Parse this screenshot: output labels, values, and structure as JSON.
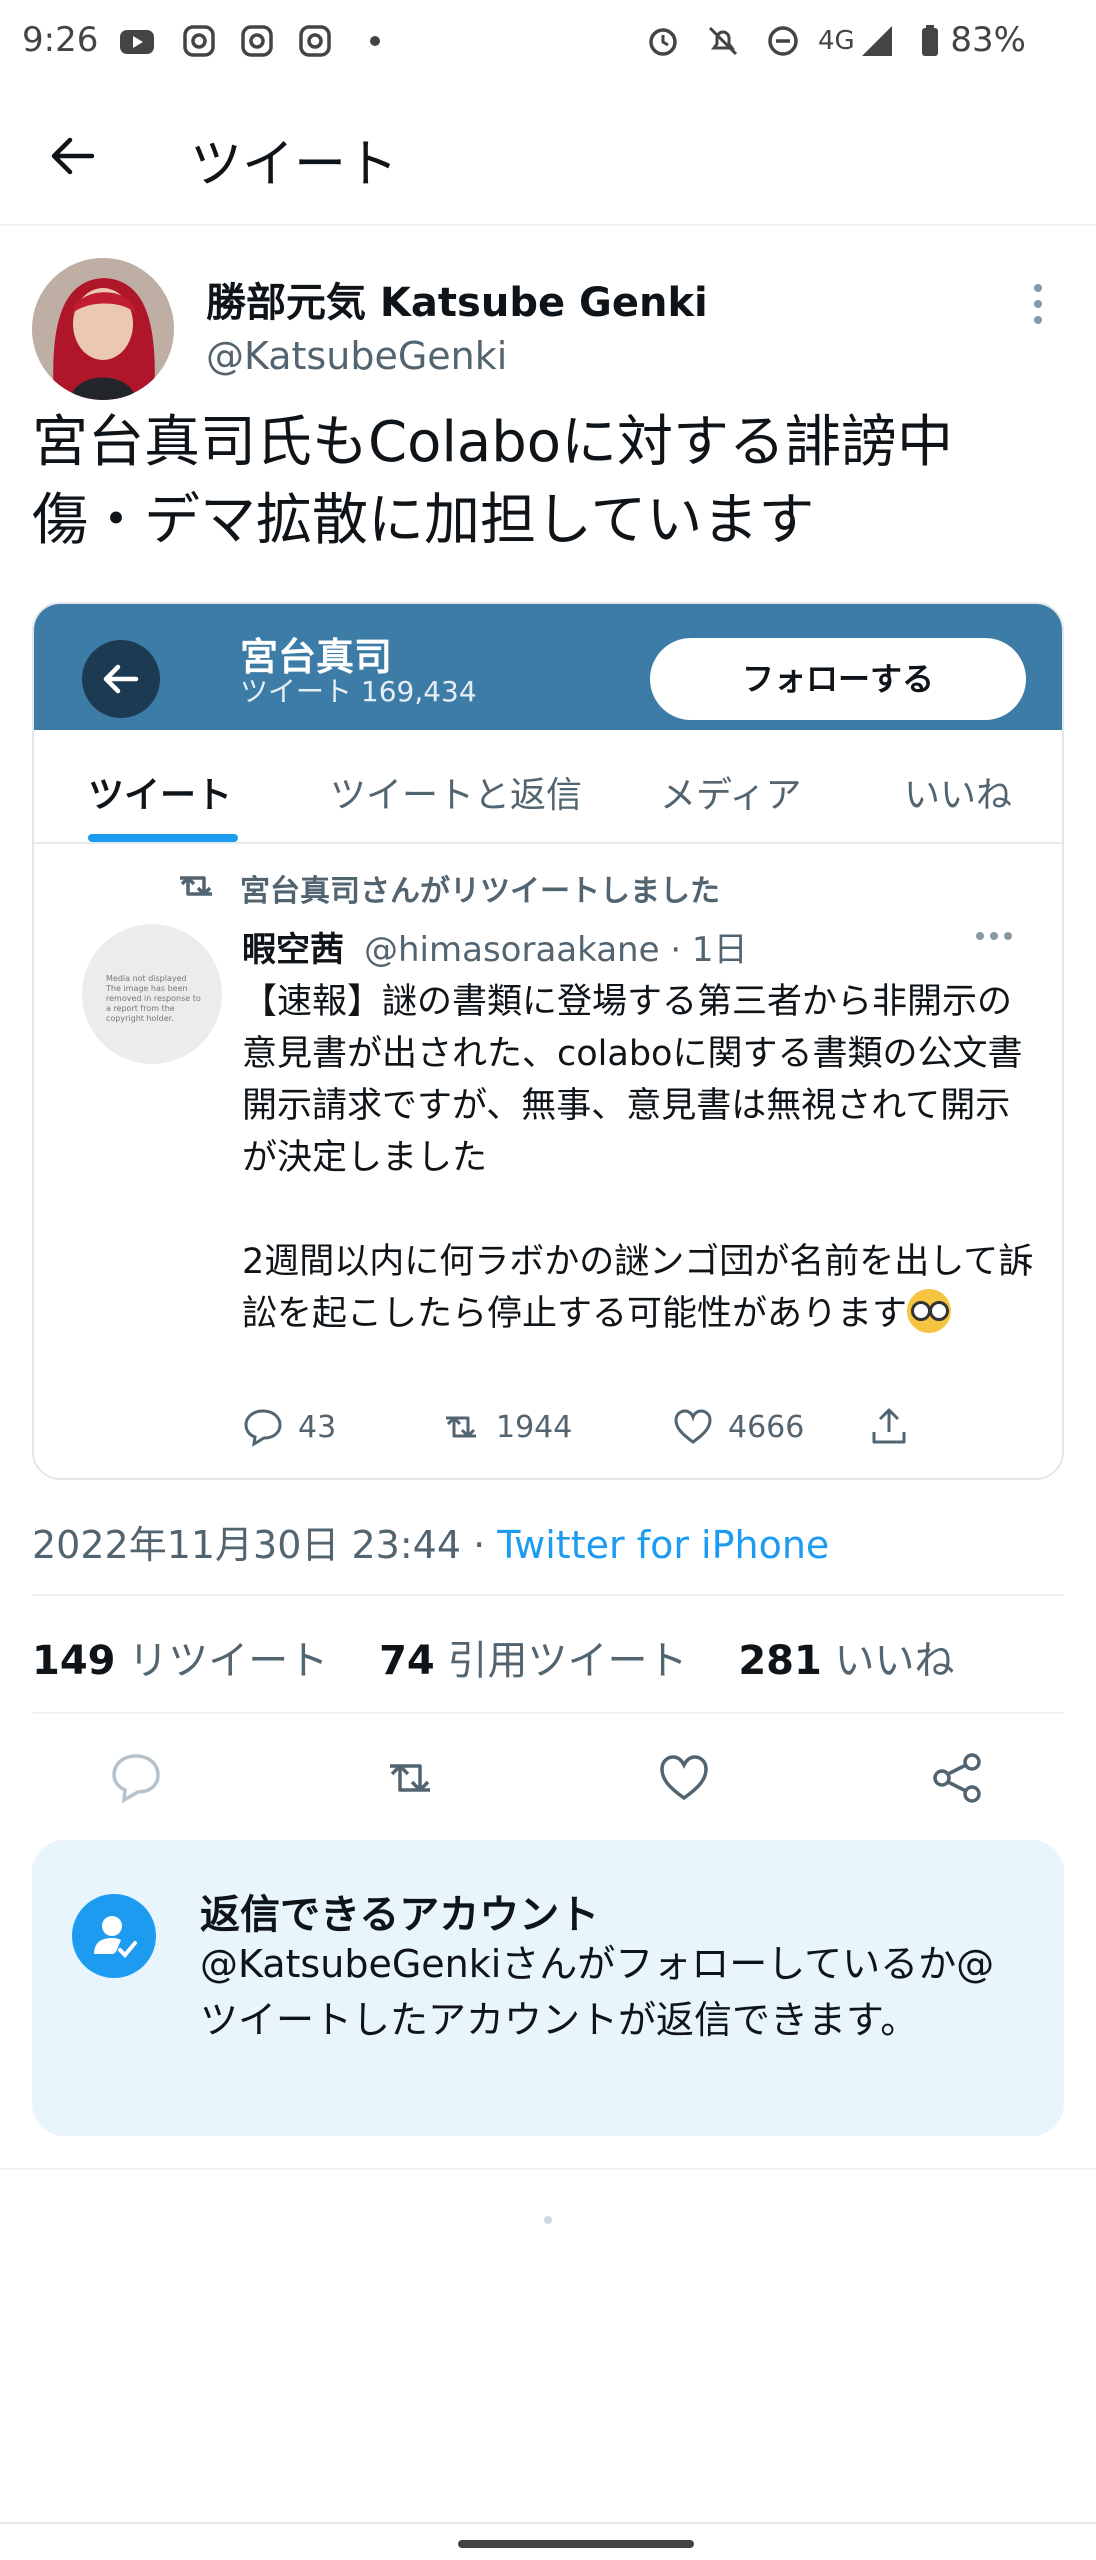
{
  "status_bar": {
    "time": "9:26",
    "network": "4G",
    "battery": "83%"
  },
  "header": {
    "title": "ツイート"
  },
  "tweet": {
    "author_name": "勝部元気 Katsube Genki",
    "author_handle": "@KatsubeGenki",
    "text": "宮台真司氏もColaboに対する誹謗中傷・デマ拡散に加担しています",
    "timestamp": "2022年11月30日 23:44 · ",
    "source": "Twitter for iPhone"
  },
  "embed": {
    "profile_name": "宮台真司",
    "tweet_count": "ツイート 169,434",
    "follow_label": "フォローする",
    "tabs": [
      "ツイート",
      "ツイートと返信",
      "メディア",
      "いいね"
    ],
    "retweet_notice": "宮台真司さんがリツイートしました",
    "inner_avatar_text": "Media not displayed The image has been removed in response to a report from the copyright holder.",
    "inner_name": "暇空茜",
    "inner_handle": "@himasoraakane · 1日",
    "inner_text": "【速報】謎の書類に登場する第三者から非開示の意見書が出された、colaboに関する書類の公文書開示請求ですが、無事、意見書は無視されて開示が決定しました\n\n2週間以内に何ラボかの謎ンゴ団が名前を出して訴訟を起こしたら停止する可能性があります",
    "replies": "43",
    "retweets": "1944",
    "likes": "4666"
  },
  "stats": {
    "retweets_count": "149",
    "retweets_label": " リツイート",
    "quotes_count": "74",
    "quotes_label": " 引用ツイート",
    "likes_count": "281",
    "likes_label": " いいね"
  },
  "reply_settings": {
    "title": "返信できるアカウント",
    "text": "@KatsubeGenkiさんがフォローしているか@ツイートしたアカウントが返信できます。"
  },
  "colors": {
    "accent": "#1d9bf0",
    "embed_header": "#3e7ca8",
    "muted": "#536471"
  }
}
